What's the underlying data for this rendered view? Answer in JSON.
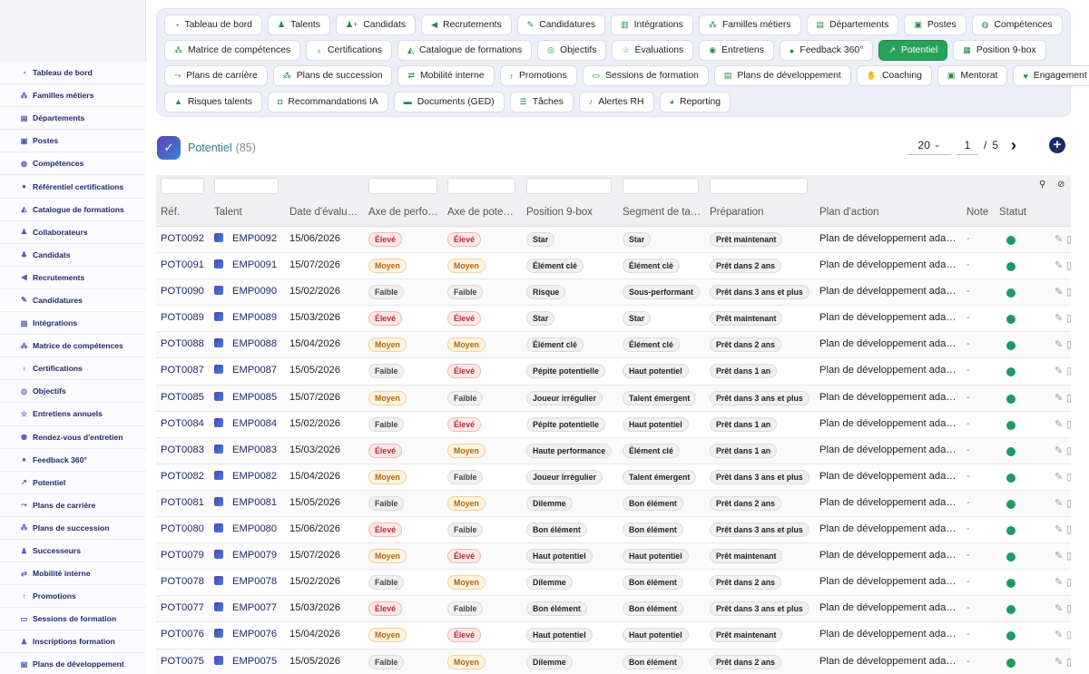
{
  "sidebar": {
    "items": [
      {
        "label": "Tableau de bord",
        "icon": "dashboard-icon",
        "glyph": "◔"
      },
      {
        "label": "Familles métiers",
        "icon": "sitemap-icon",
        "glyph": "⁂"
      },
      {
        "label": "Départements",
        "icon": "building-icon",
        "glyph": "▤"
      },
      {
        "label": "Postes",
        "icon": "id-card-icon",
        "glyph": "▣"
      },
      {
        "label": "Compétences",
        "icon": "brain-icon",
        "glyph": "◍"
      },
      {
        "label": "Référentiel certifications",
        "icon": "certificate-icon",
        "glyph": "●"
      },
      {
        "label": "Catalogue de formations",
        "icon": "graduation-cap-icon",
        "glyph": "◭"
      },
      {
        "label": "Collaborateurs",
        "icon": "user-icon",
        "glyph": "♟"
      },
      {
        "label": "Candidats",
        "icon": "user-plus-icon",
        "glyph": "♟"
      },
      {
        "label": "Recrutements",
        "icon": "bullhorn-icon",
        "glyph": "◀"
      },
      {
        "label": "Candidatures",
        "icon": "file-signature-icon",
        "glyph": "✎"
      },
      {
        "label": "Intégrations",
        "icon": "door-open-icon",
        "glyph": "▥"
      },
      {
        "label": "Matrice de compétences",
        "icon": "matrix-icon",
        "glyph": "⁂"
      },
      {
        "label": "Certifications",
        "icon": "award-icon",
        "glyph": "♁"
      },
      {
        "label": "Objectifs",
        "icon": "target-icon",
        "glyph": "◎"
      },
      {
        "label": "Entretiens annuels",
        "icon": "star-icon",
        "glyph": "☆"
      },
      {
        "label": "Rendez-vous d'entretien",
        "icon": "comments-icon",
        "glyph": "◉"
      },
      {
        "label": "Feedback 360°",
        "icon": "comment-icon",
        "glyph": "●"
      },
      {
        "label": "Potentiel",
        "icon": "chart-line-icon",
        "glyph": "↗"
      },
      {
        "label": "Plans de carrière",
        "icon": "route-icon",
        "glyph": "⤳"
      },
      {
        "label": "Plans de succession",
        "icon": "hierarchy-icon",
        "glyph": "⁂"
      },
      {
        "label": "Successeurs",
        "icon": "users-icon",
        "glyph": "♟"
      },
      {
        "label": "Mobilité interne",
        "icon": "exchange-icon",
        "glyph": "⇄"
      },
      {
        "label": "Promotions",
        "icon": "arrow-up-icon",
        "glyph": "↑"
      },
      {
        "label": "Sessions de formation",
        "icon": "chalkboard-icon",
        "glyph": "▭"
      },
      {
        "label": "Inscriptions formation",
        "icon": "user-check-icon",
        "glyph": "♟"
      },
      {
        "label": "Plans de développement",
        "icon": "clipboard-icon",
        "glyph": "▤"
      }
    ]
  },
  "topnav": {
    "rows": [
      [
        {
          "label": "Tableau de bord",
          "icon": "dashboard-icon",
          "glyph": "◔"
        },
        {
          "label": "Talents",
          "icon": "user-tie-icon",
          "glyph": "♟"
        },
        {
          "label": "Candidats",
          "icon": "user-plus-icon",
          "glyph": "♟+"
        },
        {
          "label": "Recrutements",
          "icon": "bullhorn-icon",
          "glyph": "◀"
        },
        {
          "label": "Candidatures",
          "icon": "file-signature-icon",
          "glyph": "✎"
        },
        {
          "label": "Intégrations",
          "icon": "door-open-icon",
          "glyph": "▥"
        },
        {
          "label": "Familles métiers",
          "icon": "sitemap-icon",
          "glyph": "⁂"
        },
        {
          "label": "Départements",
          "icon": "building-icon",
          "glyph": "▤"
        },
        {
          "label": "Postes",
          "icon": "id-card-icon",
          "glyph": "▣"
        },
        {
          "label": "Compétences",
          "icon": "brain-icon",
          "glyph": "◍"
        }
      ],
      [
        {
          "label": "Matrice de compétences",
          "icon": "matrix-icon",
          "glyph": "⁂"
        },
        {
          "label": "Certifications",
          "icon": "award-icon",
          "glyph": "♁"
        },
        {
          "label": "Catalogue de formations",
          "icon": "graduation-cap-icon",
          "glyph": "◭"
        },
        {
          "label": "Objectifs",
          "icon": "target-icon",
          "glyph": "◎"
        },
        {
          "label": "Évaluations",
          "icon": "star-icon",
          "glyph": "☆"
        },
        {
          "label": "Entretiens",
          "icon": "comments-icon",
          "glyph": "◉"
        },
        {
          "label": "Feedback 360°",
          "icon": "comment-icon",
          "glyph": "●"
        },
        {
          "label": "Potentiel",
          "icon": "chart-line-icon",
          "glyph": "↗",
          "active": true
        },
        {
          "label": "Position 9-box",
          "icon": "grid-icon",
          "glyph": "▦"
        }
      ],
      [
        {
          "label": "Plans de carrière",
          "icon": "route-icon",
          "glyph": "⤳"
        },
        {
          "label": "Plans de succession",
          "icon": "hierarchy-icon",
          "glyph": "⁂"
        },
        {
          "label": "Mobilité interne",
          "icon": "exchange-icon",
          "glyph": "⇄"
        },
        {
          "label": "Promotions",
          "icon": "arrow-up-icon",
          "glyph": "↑"
        },
        {
          "label": "Sessions de formation",
          "icon": "chalkboard-icon",
          "glyph": "▭"
        },
        {
          "label": "Plans de développement",
          "icon": "clipboard-icon",
          "glyph": "▤"
        },
        {
          "label": "Coaching",
          "icon": "handshake-icon",
          "glyph": "✋"
        },
        {
          "label": "Mentorat",
          "icon": "mentor-icon",
          "glyph": "▣"
        },
        {
          "label": "Engagement",
          "icon": "heart-icon",
          "glyph": "♥"
        }
      ],
      [
        {
          "label": "Risques talents",
          "icon": "warning-icon",
          "glyph": "▲"
        },
        {
          "label": "Recommandations IA",
          "icon": "robot-icon",
          "glyph": "◘"
        },
        {
          "label": "Documents (GED)",
          "icon": "folder-icon",
          "glyph": "▬"
        },
        {
          "label": "Tâches",
          "icon": "tasks-icon",
          "glyph": "☰"
        },
        {
          "label": "Alertes RH",
          "icon": "bell-icon",
          "glyph": "♪"
        },
        {
          "label": "Reporting",
          "icon": "pie-chart-icon",
          "glyph": "◕"
        }
      ]
    ]
  },
  "page": {
    "title": "Potentiel",
    "count": "(85)"
  },
  "pager": {
    "per_page": "20",
    "current": "1",
    "separator": "/",
    "total": "5"
  },
  "table": {
    "headers": [
      "Réf.",
      "Talent",
      "Date d'évalu…",
      "Axe de perfo…",
      "Axe de pote…",
      "Position 9-box",
      "Segment de ta…",
      "Préparation",
      "Plan d'action",
      "Note",
      "Statut"
    ],
    "rows": [
      {
        "ref": "POT0092",
        "emp": "EMP0092",
        "date": "15/06/2026",
        "perf": "Élevé",
        "pot": "Élevé",
        "box": "Star",
        "seg": "Star",
        "prep": "Prêt maintenant",
        "plan": "Plan de développement ada…",
        "note": "-"
      },
      {
        "ref": "POT0091",
        "emp": "EMP0091",
        "date": "15/07/2026",
        "perf": "Moyen",
        "pot": "Moyen",
        "box": "Élément clé",
        "seg": "Élément clé",
        "prep": "Prêt dans 2 ans",
        "plan": "Plan de développement ada…",
        "note": "-"
      },
      {
        "ref": "POT0090",
        "emp": "EMP0090",
        "date": "15/02/2026",
        "perf": "Faible",
        "pot": "Faible",
        "box": "Risque",
        "seg": "Sous-performant",
        "prep": "Prêt dans 3 ans et plus",
        "plan": "Plan de développement ada…",
        "note": "-"
      },
      {
        "ref": "POT0089",
        "emp": "EMP0089",
        "date": "15/03/2026",
        "perf": "Élevé",
        "pot": "Élevé",
        "box": "Star",
        "seg": "Star",
        "prep": "Prêt maintenant",
        "plan": "Plan de développement ada…",
        "note": "-"
      },
      {
        "ref": "POT0088",
        "emp": "EMP0088",
        "date": "15/04/2026",
        "perf": "Moyen",
        "pot": "Moyen",
        "box": "Élément clé",
        "seg": "Élément clé",
        "prep": "Prêt dans 2 ans",
        "plan": "Plan de développement ada…",
        "note": "-"
      },
      {
        "ref": "POT0087",
        "emp": "EMP0087",
        "date": "15/05/2026",
        "perf": "Faible",
        "pot": "Élevé",
        "box": "Pépite potentielle",
        "seg": "Haut potentiel",
        "prep": "Prêt dans 1 an",
        "plan": "Plan de développement ada…",
        "note": "-"
      },
      {
        "ref": "POT0085",
        "emp": "EMP0085",
        "date": "15/07/2026",
        "perf": "Moyen",
        "pot": "Faible",
        "box": "Joueur irrégulier",
        "seg": "Talent émergent",
        "prep": "Prêt dans 3 ans et plus",
        "plan": "Plan de développement ada…",
        "note": "-"
      },
      {
        "ref": "POT0084",
        "emp": "EMP0084",
        "date": "15/02/2026",
        "perf": "Faible",
        "pot": "Élevé",
        "box": "Pépite potentielle",
        "seg": "Haut potentiel",
        "prep": "Prêt dans 1 an",
        "plan": "Plan de développement ada…",
        "note": "-"
      },
      {
        "ref": "POT0083",
        "emp": "EMP0083",
        "date": "15/03/2026",
        "perf": "Élevé",
        "pot": "Moyen",
        "box": "Haute performance",
        "seg": "Élément clé",
        "prep": "Prêt dans 1 an",
        "plan": "Plan de développement ada…",
        "note": "-"
      },
      {
        "ref": "POT0082",
        "emp": "EMP0082",
        "date": "15/04/2026",
        "perf": "Moyen",
        "pot": "Faible",
        "box": "Joueur irrégulier",
        "seg": "Talent émergent",
        "prep": "Prêt dans 3 ans et plus",
        "plan": "Plan de développement ada…",
        "note": "-"
      },
      {
        "ref": "POT0081",
        "emp": "EMP0081",
        "date": "15/05/2026",
        "perf": "Faible",
        "pot": "Moyen",
        "box": "Dilemme",
        "seg": "Bon élément",
        "prep": "Prêt dans 2 ans",
        "plan": "Plan de développement ada…",
        "note": "-"
      },
      {
        "ref": "POT0080",
        "emp": "EMP0080",
        "date": "15/06/2026",
        "perf": "Élevé",
        "pot": "Faible",
        "box": "Bon élément",
        "seg": "Bon élément",
        "prep": "Prêt dans 3 ans et plus",
        "plan": "Plan de développement ada…",
        "note": "-"
      },
      {
        "ref": "POT0079",
        "emp": "EMP0079",
        "date": "15/07/2026",
        "perf": "Moyen",
        "pot": "Élevé",
        "box": "Haut potentiel",
        "seg": "Haut potentiel",
        "prep": "Prêt maintenant",
        "plan": "Plan de développement ada…",
        "note": "-"
      },
      {
        "ref": "POT0078",
        "emp": "EMP0078",
        "date": "15/02/2026",
        "perf": "Faible",
        "pot": "Moyen",
        "box": "Dilemme",
        "seg": "Bon élément",
        "prep": "Prêt dans 2 ans",
        "plan": "Plan de développement ada…",
        "note": "-"
      },
      {
        "ref": "POT0077",
        "emp": "EMP0077",
        "date": "15/03/2026",
        "perf": "Élevé",
        "pot": "Faible",
        "box": "Bon élément",
        "seg": "Bon élément",
        "prep": "Prêt dans 3 ans et plus",
        "plan": "Plan de développement ada…",
        "note": "-"
      },
      {
        "ref": "POT0076",
        "emp": "EMP0076",
        "date": "15/04/2026",
        "perf": "Moyen",
        "pot": "Élevé",
        "box": "Haut potentiel",
        "seg": "Haut potentiel",
        "prep": "Prêt maintenant",
        "plan": "Plan de développement ada…",
        "note": "-"
      },
      {
        "ref": "POT0075",
        "emp": "EMP0075",
        "date": "15/05/2026",
        "perf": "Faible",
        "pot": "Moyen",
        "box": "Dilemme",
        "seg": "Bon élément",
        "prep": "Prêt dans 2 ans",
        "plan": "Plan de développement ada…",
        "note": "-"
      }
    ]
  },
  "colors": {
    "accent": "#26a35a",
    "status_active": "#1f9a64",
    "brand_navy": "#1e2a6e"
  }
}
